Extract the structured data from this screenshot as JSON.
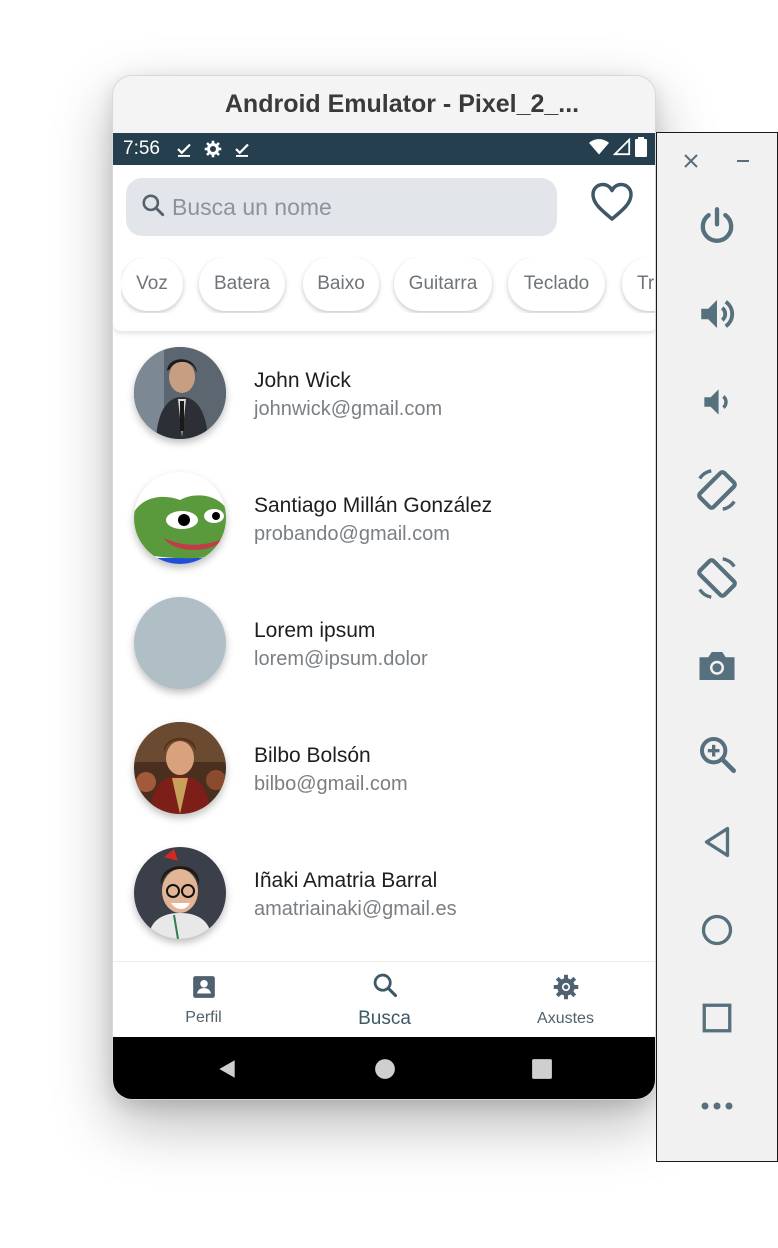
{
  "window": {
    "title": "Android Emulator - Pixel_2_..."
  },
  "statusbar": {
    "time": "7:56"
  },
  "search": {
    "placeholder": "Busca un nome"
  },
  "chips": [
    "Voz",
    "Batera",
    "Baixo",
    "Guitarra",
    "Teclado",
    "Tro"
  ],
  "contacts": [
    {
      "name": "John Wick",
      "email": "johnwick@gmail.com"
    },
    {
      "name": "Santiago Millán González",
      "email": "probando@gmail.com"
    },
    {
      "name": "Lorem ipsum",
      "email": "lorem@ipsum.dolor"
    },
    {
      "name": "Bilbo Bolsón",
      "email": "bilbo@gmail.com"
    },
    {
      "name": "Iñaki Amatria Barral",
      "email": "amatriainaki@gmail.es"
    }
  ],
  "bottomnav": {
    "perfil": "Perfil",
    "busca": "Busca",
    "axustes": "Axustes"
  },
  "colors": {
    "statusbar": "#263f4f",
    "accent": "#3f5868",
    "searchbg": "#e2e6ea",
    "toolbar_icon": "#56707e"
  }
}
